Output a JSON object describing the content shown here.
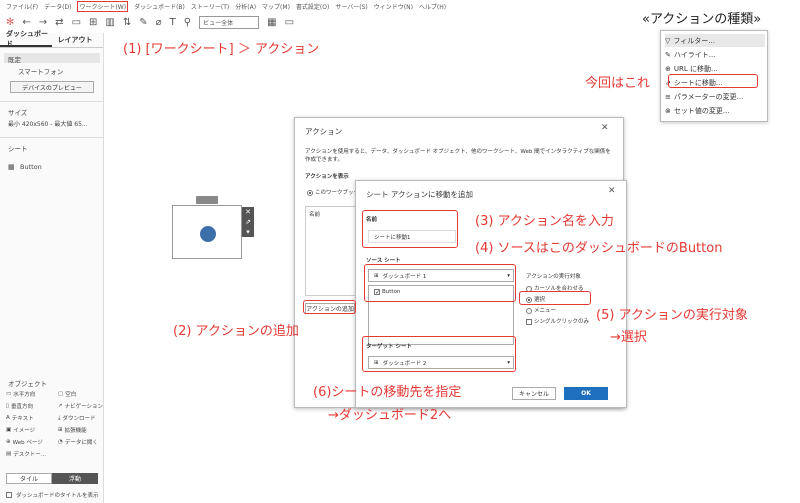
{
  "menubar": [
    "ファイル(F)",
    "データ(D)",
    "ワークシート(W)",
    "ダッシュボード(B)",
    "ストーリー(T)",
    "分析(A)",
    "マップ(M)",
    "書式設定(O)",
    "サーバー(S)",
    "ウィンドウ(N)",
    "ヘルプ(H)"
  ],
  "toolbar": {
    "view_select": "ビュー全体"
  },
  "left_panel": {
    "tab_dashboard": "ダッシュボード",
    "tab_layout": "レイアウト",
    "default_label": "既定",
    "device_label": "スマートフォン",
    "preview_button": "デバイスのプレビュー",
    "size_heading": "サイズ",
    "size_value": "最小 420x560 - 最大値 65...",
    "sheets_heading": "シート",
    "sheet_item": "Button",
    "objects_heading": "オブジェクト",
    "objects": [
      "水平方向",
      "空白",
      "垂直方向",
      "ナビゲーション",
      "テキスト",
      "ダウンロード",
      "イメージ",
      "拡張機能",
      "Web ページ",
      "データに聞く",
      "デスクトー..."
    ],
    "tiled_button": "タイル",
    "floating_button": "浮動",
    "show_title_label": "ダッシュボードのタイトルを表示"
  },
  "action_dialog": {
    "title": "アクション",
    "description": "アクションを使用すると、データ、ダッシュボード オブジェクト、他のワークシート、Web 間でインタラクティブな関係を作成できます。",
    "show_actions_label": "アクションを表示",
    "radio_this_workbook": "このワークブック",
    "col_name": "名前",
    "add_action_button": "アクションの追加"
  },
  "goto_dialog": {
    "title": "シート アクションに移動を追加",
    "name_label": "名前",
    "name_value": "シートに移動1",
    "source_label": "ソース シート",
    "source_select": "ダッシュボード 1",
    "source_checkbox": "Button",
    "run_label": "アクションの実行対象",
    "run_options": [
      "カーソルを合わせる",
      "選択",
      "メニュー"
    ],
    "single_click": "シングルクリックのみ",
    "target_label": "ターゲット シート",
    "target_select": "ダッシュボード 2",
    "cancel_button": "キャンセル",
    "ok_button": "OK"
  },
  "action_types_popup": {
    "heading": "«アクションの種類»",
    "items": [
      "フィルター...",
      "ハイライト...",
      "URL に移動...",
      "シートに移動...",
      "パラメーターの変更...",
      "セット値の変更..."
    ]
  },
  "annotations": {
    "step1": "(1) [ワークシート] ＞ アクション",
    "step2": "(2) アクションの追加",
    "step3": "(3) アクション名を入力",
    "step4": "(4) ソースはこのダッシュボードのButton",
    "step5a": "(5) アクションの実行対象",
    "step5b": "→選択",
    "step6a": "(6)シートの移動先を指定",
    "step6b": "→ダッシュボード2へ",
    "this_time": "今回はこれ"
  },
  "colors": {
    "accent_red": "#e53935",
    "ok_blue": "#1f6fbf",
    "button_dot": "#3d6fa8"
  }
}
